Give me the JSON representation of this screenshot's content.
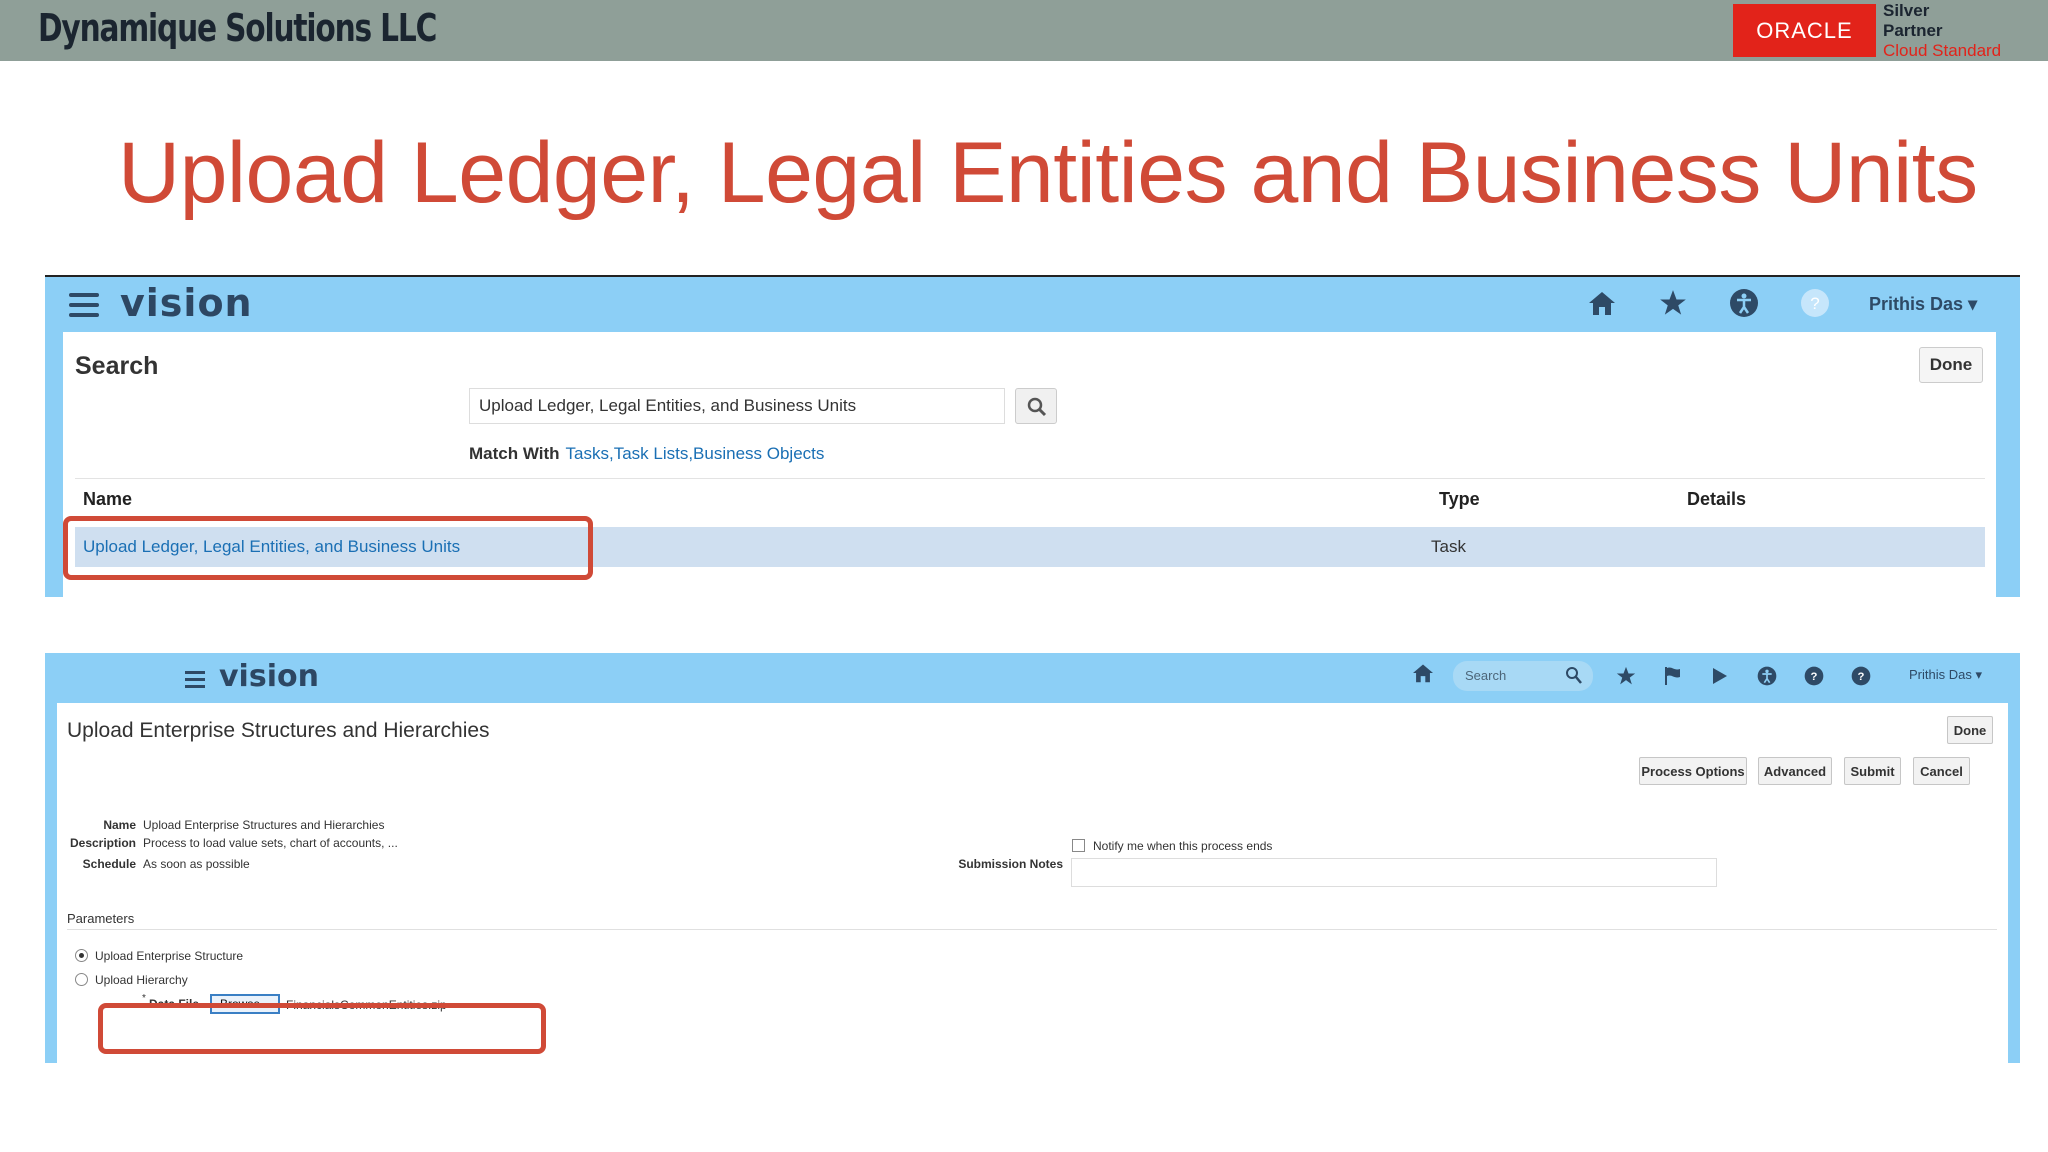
{
  "header": {
    "company": "Dynamique Solutions LLC",
    "oracle_logo": "ORACLE",
    "partner_line1": "Silver",
    "partner_line2": "Partner",
    "partner_line3": "Cloud Standard"
  },
  "slide_title": "Upload Ledger, Legal Entities and Business Units",
  "screen1": {
    "app_logo": "vision",
    "icons": [
      "menu-icon",
      "home-icon",
      "star-icon",
      "accessibility-icon",
      "help-icon"
    ],
    "help_glyph": "?",
    "user": "Prithis Das",
    "page_title": "Search",
    "done_label": "Done",
    "search_value": "Upload Ledger, Legal Entities, and Business Units",
    "match_label": "Match With",
    "match_links": "Tasks,Task Lists,Business Objects",
    "columns": [
      "Name",
      "Type",
      "Details"
    ],
    "rows": [
      {
        "name": "Upload Ledger, Legal Entities, and Business Units",
        "type": "Task"
      }
    ]
  },
  "screen2": {
    "app_logo": "vision",
    "search_placeholder": "Search",
    "icons": [
      "menu-icon",
      "home-icon",
      "search-icon",
      "star-icon",
      "flag-icon",
      "bell-icon",
      "accessibility-icon",
      "help-icon",
      "help-icon"
    ],
    "help_glyph": "?",
    "user": "Prithis Das",
    "page_title": "Upload Enterprise Structures and Hierarchies",
    "done_label": "Done",
    "buttons": {
      "process_options": "Process Options",
      "advanced": "Advanced",
      "submit": "Submit",
      "cancel": "Cancel"
    },
    "fields": {
      "name_label": "Name",
      "name_value": "Upload Enterprise Structures and Hierarchies",
      "description_label": "Description",
      "description_value": "Process to load value sets, chart of accounts, ...",
      "schedule_label": "Schedule",
      "schedule_value": "As soon as possible",
      "notify_label": "Notify me when this process ends",
      "submission_notes_label": "Submission Notes"
    },
    "parameters_label": "Parameters",
    "radio_options": [
      {
        "label": "Upload Enterprise Structure",
        "selected": true
      },
      {
        "label": "Upload Hierarchy",
        "selected": false
      }
    ],
    "required_mark": "*",
    "data_file_label": "Data File",
    "browse_label": "Browse...",
    "data_file_value": "FinancialsCommonEntities.zip"
  }
}
